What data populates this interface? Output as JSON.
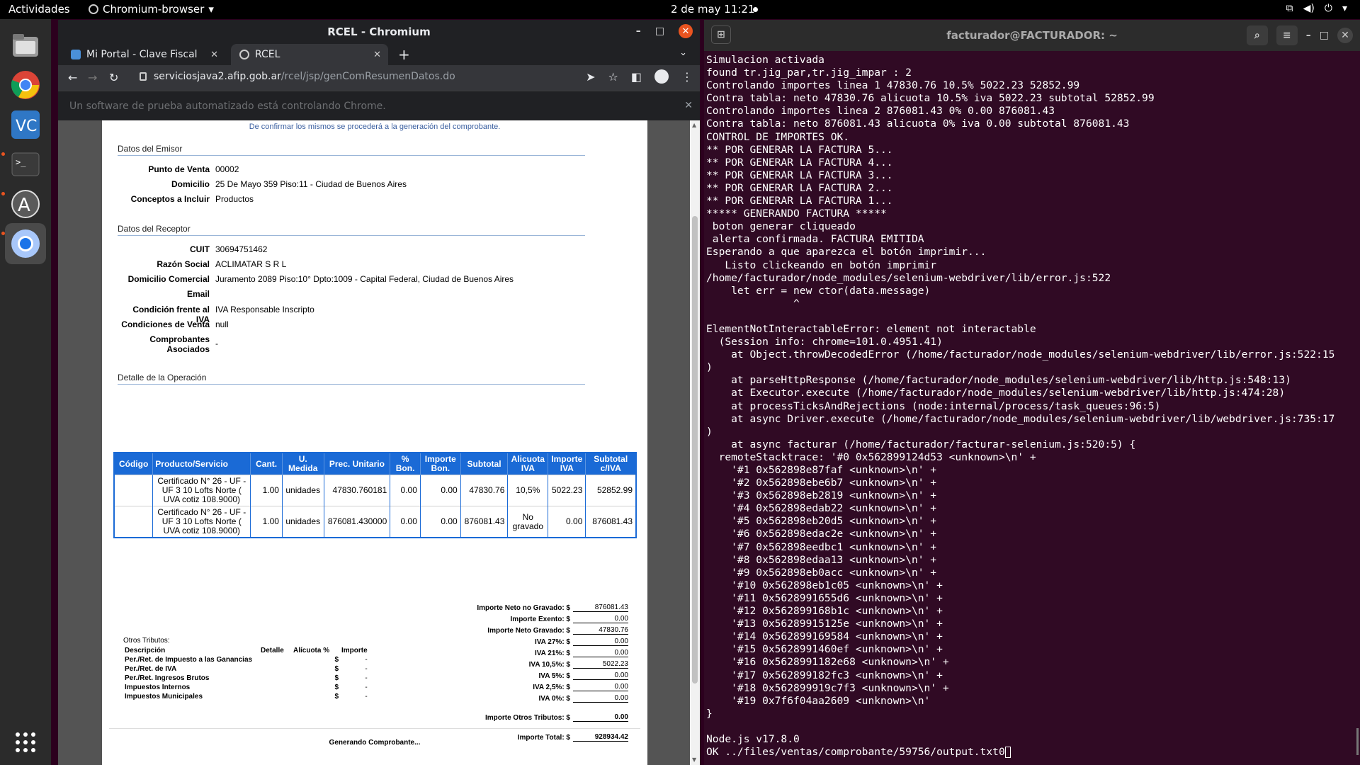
{
  "topbar": {
    "activities": "Actividades",
    "app_name": "Chromium-browser",
    "clock": "2 de may  11:21"
  },
  "dock": {
    "items": [
      "files-icon",
      "chrome-icon",
      "vscode-icon",
      "terminal-icon",
      "software-icon",
      "chromium-icon",
      "app-grid-icon"
    ]
  },
  "browser": {
    "window_title": "RCEL - Chromium",
    "tabs": [
      {
        "label": "Mi Portal - Clave Fiscal"
      },
      {
        "label": "RCEL"
      }
    ],
    "url_host": "serviciosjava2.afip.gob.ar",
    "url_path": "/rcel/jsp/genComResumenDatos.do",
    "infobar_text": "Un software de prueba automatizado está controlando Chrome."
  },
  "page": {
    "confirm_text": "De confirmar los mismos se procederá a la generación del comprobante.",
    "emisor": {
      "title": "Datos del Emisor",
      "fields": [
        {
          "label": "Punto de Venta",
          "value": "00002"
        },
        {
          "label": "Domicilio",
          "value": "25 De Mayo 359 Piso:11 - Ciudad de Buenos Aires"
        },
        {
          "label": "Conceptos a Incluir",
          "value": "Productos"
        }
      ]
    },
    "receptor": {
      "title": "Datos del Receptor",
      "fields": [
        {
          "label": "CUIT",
          "value": "30694751462"
        },
        {
          "label": "Razón Social",
          "value": "ACLIMATAR S R L"
        },
        {
          "label": "Domicilio Comercial",
          "value": "Juramento 2089 Piso:10° Dpto:1009 - Capital Federal, Ciudad de Buenos Aires"
        },
        {
          "label": "Email",
          "value": ""
        },
        {
          "label": "Condición frente al IVA",
          "value": "IVA Responsable Inscripto"
        },
        {
          "label": "Condiciones de Venta",
          "value": "null"
        },
        {
          "label": "Comprobantes Asociados",
          "value": "-"
        }
      ]
    },
    "detalle": {
      "title": "Detalle de la Operación",
      "headers": [
        "Código",
        "Producto/Servicio",
        "Cant.",
        "U. Medida",
        "Prec. Unitario",
        "% Bon.",
        "Importe Bon.",
        "Subtotal",
        "Alicuota IVA",
        "Importe IVA",
        "Subtotal c/IVA"
      ],
      "rows": [
        [
          "",
          "Certificado N° 26 - UF - UF 3 10 Lofts Norte ( UVA cotiz 108.9000)",
          "1.00",
          "unidades",
          "47830.760181",
          "0.00",
          "0.00",
          "47830.76",
          "10,5%",
          "5022.23",
          "52852.99"
        ],
        [
          "",
          "Certificado N° 26 - UF - UF 3 10 Lofts Norte ( UVA cotiz 108.9000)",
          "1.00",
          "unidades",
          "876081.430000",
          "0.00",
          "0.00",
          "876081.43",
          "No gravado",
          "0.00",
          "876081.43"
        ]
      ]
    },
    "totales": [
      {
        "label": "Importe Neto no Gravado: $",
        "value": "876081.43"
      },
      {
        "label": "Importe Exento: $",
        "value": "0.00"
      },
      {
        "label": "Importe Neto Gravado: $",
        "value": "47830.76"
      },
      {
        "label": "IVA 27%: $",
        "value": "0.00"
      },
      {
        "label": "IVA 21%: $",
        "value": "0.00"
      },
      {
        "label": "IVA 10,5%: $",
        "value": "5022.23"
      },
      {
        "label": "IVA 5%: $",
        "value": "0.00"
      },
      {
        "label": "IVA 2,5%: $",
        "value": "0.00"
      },
      {
        "label": "IVA 0%: $",
        "value": "0.00"
      }
    ],
    "otros_tributos_total": {
      "label": "Importe Otros Tributos: $",
      "value": "0.00"
    },
    "importe_total": {
      "label": "Importe Total: $",
      "value": "928934.42"
    },
    "otros": {
      "title": "Otros Tributos:",
      "headers": [
        "Descripción",
        "Detalle",
        "Alícuota %",
        "Importe"
      ],
      "rows": [
        {
          "desc": "Per./Ret. de Impuesto a las Ganancias",
          "cur": "$",
          "imp": "-"
        },
        {
          "desc": "Per./Ret. de IVA",
          "cur": "$",
          "imp": "-"
        },
        {
          "desc": "Per./Ret. Ingresos Brutos",
          "cur": "$",
          "imp": "-"
        },
        {
          "desc": "Impuestos Internos",
          "cur": "$",
          "imp": "-"
        },
        {
          "desc": "Impuestos Municipales",
          "cur": "$",
          "imp": "-"
        }
      ]
    },
    "generating_text": "Generando Comprobante..."
  },
  "terminal": {
    "title": "facturador@FACTURADOR: ~",
    "lines": [
      "Simulacion activada",
      "found tr.jig_par,tr.jig_impar : 2",
      "Controlando importes linea 1 47830.76 10.5% 5022.23 52852.99",
      "Contra tabla: neto 47830.76 alicuota 10.5% iva 5022.23 subtotal 52852.99",
      "Controlando importes linea 2 876081.43 0% 0.00 876081.43",
      "Contra tabla: neto 876081.43 alicuota 0% iva 0.00 subtotal 876081.43",
      "CONTROL DE IMPORTES OK.",
      "** POR GENERAR LA FACTURA 5...",
      "** POR GENERAR LA FACTURA 4...",
      "** POR GENERAR LA FACTURA 3...",
      "** POR GENERAR LA FACTURA 2...",
      "** POR GENERAR LA FACTURA 1...",
      "***** GENERANDO FACTURA *****",
      " boton generar cliqueado",
      " alerta confirmada. FACTURA EMITIDA",
      "Esperando a que aparezca el botón imprimir...",
      "   Listo clickeando en botón imprimir",
      "/home/facturador/node_modules/selenium-webdriver/lib/error.js:522",
      "    let err = new ctor(data.message)",
      "              ^",
      "",
      "ElementNotInteractableError: element not interactable",
      "  (Session info: chrome=101.0.4951.41)",
      "    at Object.throwDecodedError (/home/facturador/node_modules/selenium-webdriver/lib/error.js:522:15",
      ")",
      "    at parseHttpResponse (/home/facturador/node_modules/selenium-webdriver/lib/http.js:548:13)",
      "    at Executor.execute (/home/facturador/node_modules/selenium-webdriver/lib/http.js:474:28)",
      "    at processTicksAndRejections (node:internal/process/task_queues:96:5)",
      "    at async Driver.execute (/home/facturador/node_modules/selenium-webdriver/lib/webdriver.js:735:17",
      ")",
      "    at async facturar (/home/facturador/facturar-selenium.js:520:5) {",
      "  remoteStacktrace: '#0 0x562899124d53 <unknown>\\n' +",
      "    '#1 0x562898e87faf <unknown>\\n' +",
      "    '#2 0x562898ebe6b7 <unknown>\\n' +",
      "    '#3 0x562898eb2819 <unknown>\\n' +",
      "    '#4 0x562898edab22 <unknown>\\n' +",
      "    '#5 0x562898eb20d5 <unknown>\\n' +",
      "    '#6 0x562898edac2e <unknown>\\n' +",
      "    '#7 0x562898eedbc1 <unknown>\\n' +",
      "    '#8 0x562898edaa13 <unknown>\\n' +",
      "    '#9 0x562898eb0acc <unknown>\\n' +",
      "    '#10 0x562898eb1c05 <unknown>\\n' +",
      "    '#11 0x5628991655d6 <unknown>\\n' +",
      "    '#12 0x562899168b1c <unknown>\\n' +",
      "    '#13 0x56289915125e <unknown>\\n' +",
      "    '#14 0x562899169584 <unknown>\\n' +",
      "    '#15 0x5628991460ef <unknown>\\n' +",
      "    '#16 0x5628991182e68 <unknown>\\n' +",
      "    '#17 0x562899182fc3 <unknown>\\n' +",
      "    '#18 0x562899919c7f3 <unknown>\\n' +",
      "    '#19 0x7f6f04aa2609 <unknown>\\n'",
      "}",
      "",
      "Node.js v17.8.0",
      "OK ../files/ventas/comprobante/59756/output.txt0"
    ]
  }
}
